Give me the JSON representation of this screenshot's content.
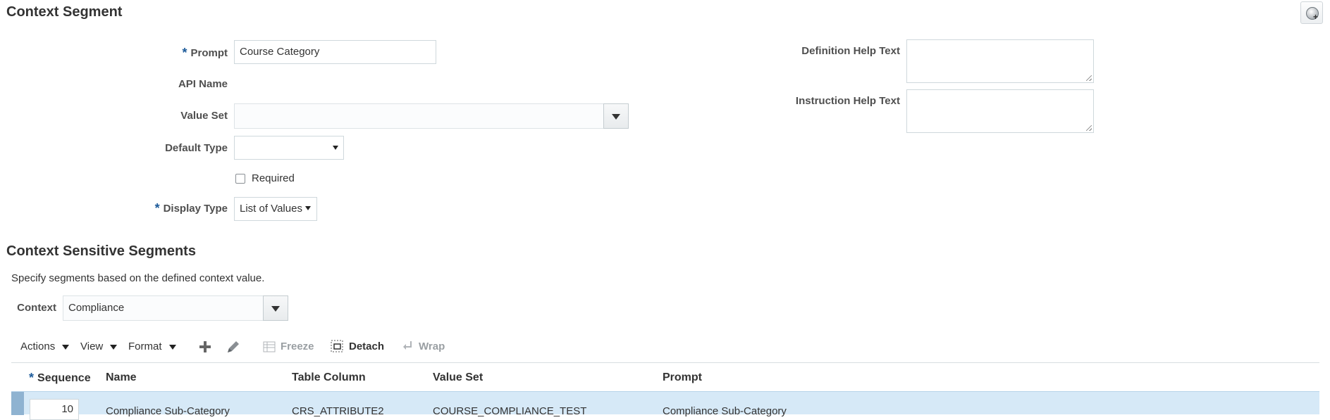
{
  "context_segment": {
    "title": "Context Segment",
    "prompt": {
      "label": "Prompt",
      "required_marker": "*",
      "value": "Course Category"
    },
    "api_name": {
      "label": "API Name"
    },
    "value_set": {
      "label": "Value Set",
      "value": ""
    },
    "default_type": {
      "label": "Default Type",
      "value": ""
    },
    "required_checkbox": {
      "label": "Required",
      "checked": false
    },
    "display_type": {
      "label": "Display Type",
      "required_marker": "*",
      "value": "List of Values"
    },
    "definition_help_text": {
      "label": "Definition Help Text",
      "value": ""
    },
    "instruction_help_text": {
      "label": "Instruction Help Text",
      "value": ""
    }
  },
  "context_sensitive_segments": {
    "title": "Context Sensitive Segments",
    "description": "Specify segments based on the defined context value.",
    "context": {
      "label": "Context",
      "value": "Compliance"
    }
  },
  "toolbar": {
    "actions": "Actions",
    "view": "View",
    "format": "Format",
    "add_icon": "plus-icon",
    "edit_icon": "pencil-icon",
    "freeze": "Freeze",
    "detach": "Detach",
    "wrap": "Wrap"
  },
  "table": {
    "columns": {
      "sequence": "Sequence",
      "sequence_required_marker": "*",
      "name": "Name",
      "table_column": "Table Column",
      "value_set": "Value Set",
      "prompt": "Prompt"
    },
    "rows": [
      {
        "sequence": "10",
        "name": "Compliance Sub-Category",
        "table_column": "CRS_ATTRIBUTE2",
        "value_set": "COURSE_COMPLIANCE_TEST",
        "prompt": "Compliance Sub-Category"
      }
    ]
  },
  "colors": {
    "required_marker": "#1d5b9a",
    "selected_row": "#d6e9f7",
    "disabled_text": "#9a9fa3"
  }
}
